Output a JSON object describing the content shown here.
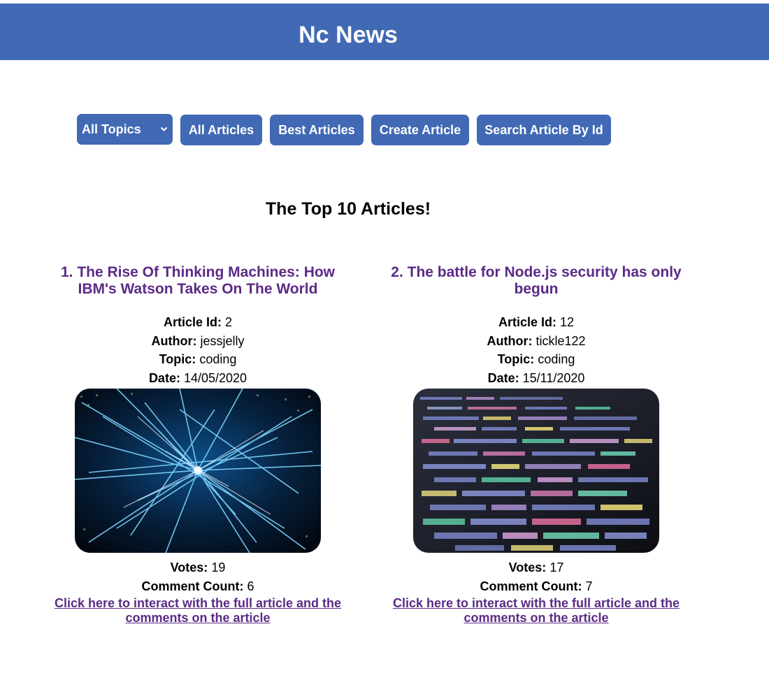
{
  "header": {
    "title": "Nc News"
  },
  "toolbar": {
    "topic_select": {
      "selected": "All Topics",
      "chevron_icon": "chevron-down-icon"
    },
    "buttons": {
      "all_articles": "All Articles",
      "best_articles": "Best Articles",
      "create_article": "Create Article",
      "search_by_id": "Search Article By Id"
    }
  },
  "main": {
    "heading": "The Top 10 Articles!",
    "labels": {
      "article_id": "Article Id:",
      "author": "Author:",
      "topic": "Topic:",
      "date": "Date:",
      "votes": "Votes:",
      "comment_count": "Comment Count:"
    },
    "articles": [
      {
        "title": "1. The Rise Of Thinking Machines: How IBM's Watson Takes On The World",
        "article_id": "2",
        "author": "jessjelly",
        "topic": "coding",
        "date": "14/05/2020",
        "votes": "19",
        "comment_count": "6",
        "link_text": "Click here to interact with the full article and the comments on the article"
      },
      {
        "title": "2. The battle for Node.js security has only begun",
        "article_id": "12",
        "author": "tickle122",
        "topic": "coding",
        "date": "15/11/2020",
        "votes": "17",
        "comment_count": "7",
        "link_text": "Click here to interact with the full article and the comments on the article"
      }
    ]
  },
  "colors": {
    "brand": "#4169b4",
    "link": "#5b2a86"
  }
}
